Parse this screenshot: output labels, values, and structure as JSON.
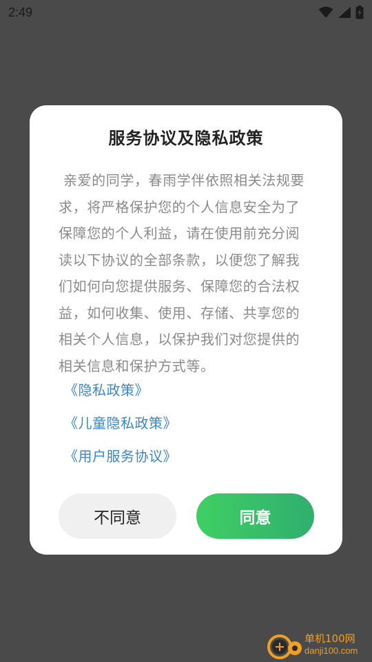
{
  "status_bar": {
    "time": "2:49",
    "icons": [
      "wifi-icon",
      "cellular-signal-icon",
      "battery-charging-icon"
    ]
  },
  "dialog": {
    "title": "服务协议及隐私政策",
    "body_lines": [
      " 亲爱的同学，春雨学伴依照相关法规要",
      "求，将严格保护您的个人信息安全为了",
      "保障您的个人利益，请在使用前充分阅",
      "读以下协议的全部条款，以便您了解我",
      "们如何向您提供服务、保障您的合法权",
      "益，如何收集、使用、存储、共享您的",
      "相关个人信息，以保护我们对您提供的",
      "相关信息和保护方式等。"
    ],
    "links": {
      "privacy_policy": "《隐私政策》",
      "child_privacy_policy": "《儿童隐私政策》",
      "user_service_agreement": "《用户服务协议》"
    },
    "buttons": {
      "disagree": "不同意",
      "agree": "同意"
    }
  },
  "watermark": {
    "title": "单机100网",
    "url": "danji100.com",
    "icon": "danji100-logo-icon"
  },
  "colors": {
    "overlay": "#4a4a4a",
    "link": "#3a86c8",
    "agree_gradient_start": "#3fcf63",
    "agree_gradient_end": "#2faf6f",
    "watermark": "#f0a020"
  }
}
